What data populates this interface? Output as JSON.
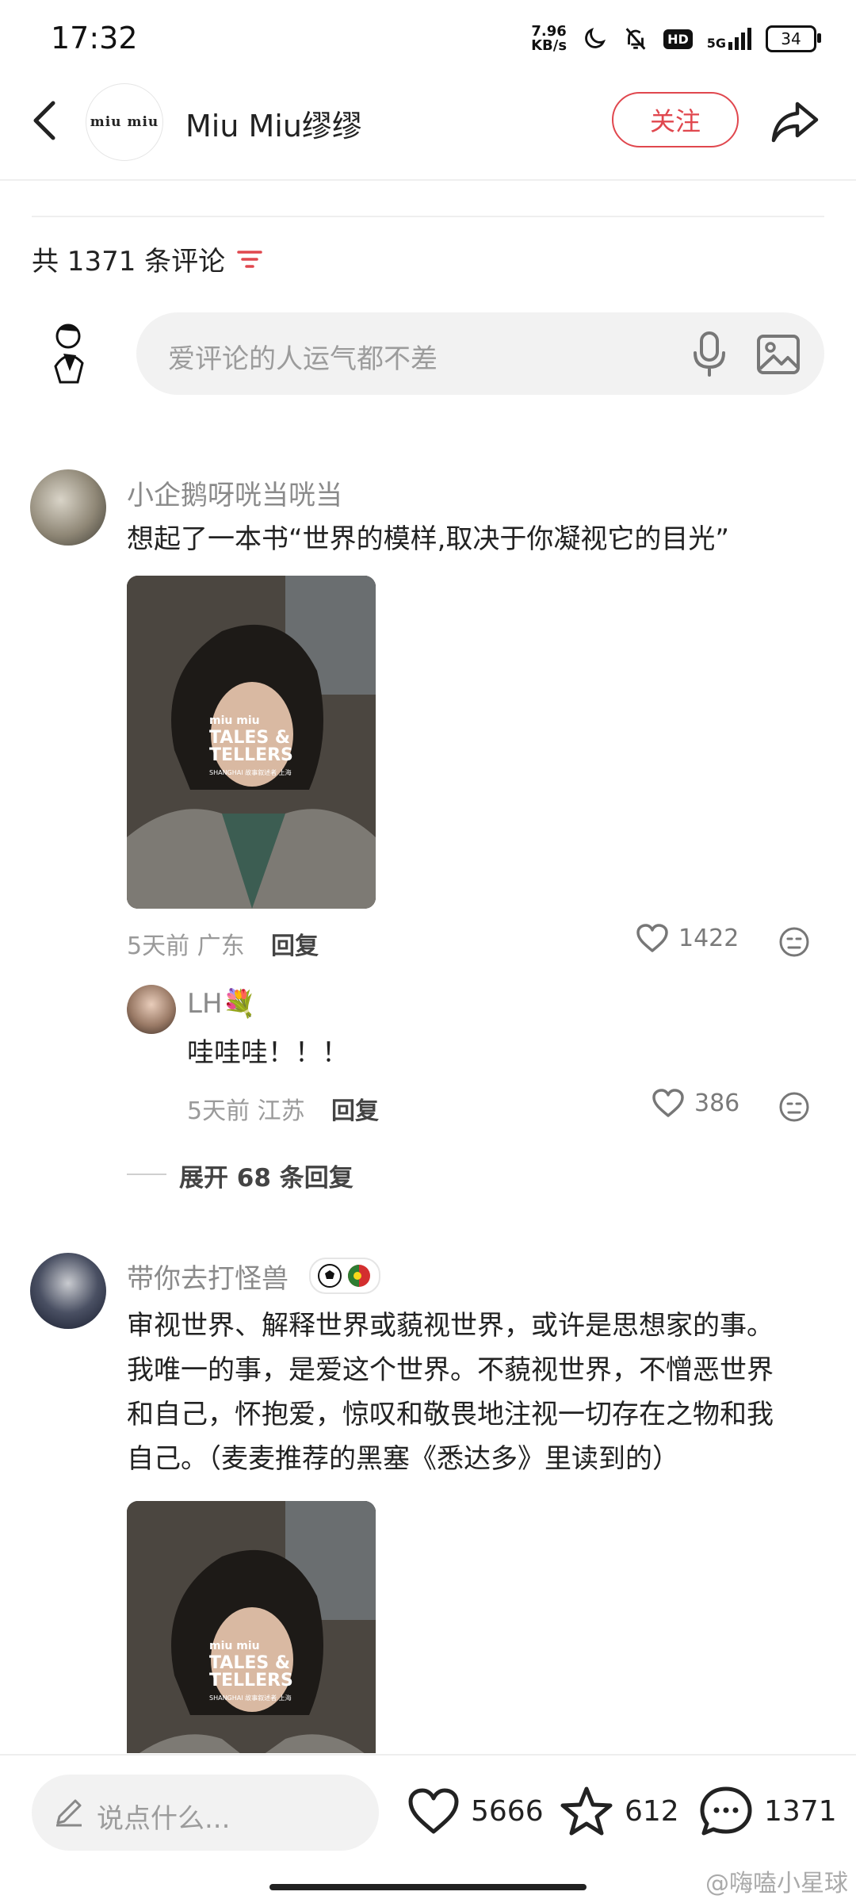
{
  "status_bar": {
    "time": "17:32",
    "net_speed_value": "7.96",
    "net_speed_unit": "KB/s",
    "hd_label": "HD",
    "network": "5G",
    "battery": "34"
  },
  "header": {
    "back_icon": "chevron-left-icon",
    "logo_text": "miu miu",
    "account_name": "Miu Miu缪缪",
    "follow_label": "关注",
    "share_icon": "share-arrow-icon"
  },
  "comments_section": {
    "count_label": "共 1371 条评论",
    "sort_icon": "filter-lines-icon",
    "input_placeholder": "爱评论的人运气都不差",
    "mic_icon": "microphone-icon",
    "image_icon": "image-icon"
  },
  "comments": [
    {
      "username": "小企鹅呀咣当咣当",
      "text": "想起了一本书“世界的模样,取决于你凝视它的目光”",
      "image_lines": [
        "miu miu",
        "TALES &",
        "TELLERS",
        "SHANGHAI 故事叙述者 上海"
      ],
      "time_location": "5天前 广东",
      "reply_label": "回复",
      "likes": "1422",
      "sub_replies": [
        {
          "username": "LH💐",
          "text": "哇哇哇！！！",
          "time_location": "5天前 江苏",
          "reply_label": "回复",
          "likes": "386"
        }
      ],
      "expand_label": "展开 68 条回复"
    },
    {
      "username": "带你去打怪兽",
      "badge_icons": [
        "soccer-ball-icon",
        "portugal-flag-icon"
      ],
      "text_lines": [
        "审视世界、解释世界或藐视世界，或许是思想家的事。",
        "我唯一的事，是爱这个世界。不藐视世界，不憎恶世界",
        "和自己，怀抱爱，惊叹和敬畏地注视一切存在之物和我",
        "自己。（麦麦推荐的黑塞《悉达多》里读到的）"
      ],
      "image_lines": [
        "miu miu",
        "TALES &",
        "TELLERS",
        "SHANGHAI 故事叙述者 上海"
      ]
    }
  ],
  "bottom_bar": {
    "input_placeholder": "说点什么...",
    "likes": "5666",
    "favorites": "612",
    "comments": "1371"
  },
  "watermark": "@嗨嗑小星球",
  "colors": {
    "accent": "#e0474e",
    "muted_text": "#9a9a9a",
    "input_bg": "#f2f2f2"
  }
}
